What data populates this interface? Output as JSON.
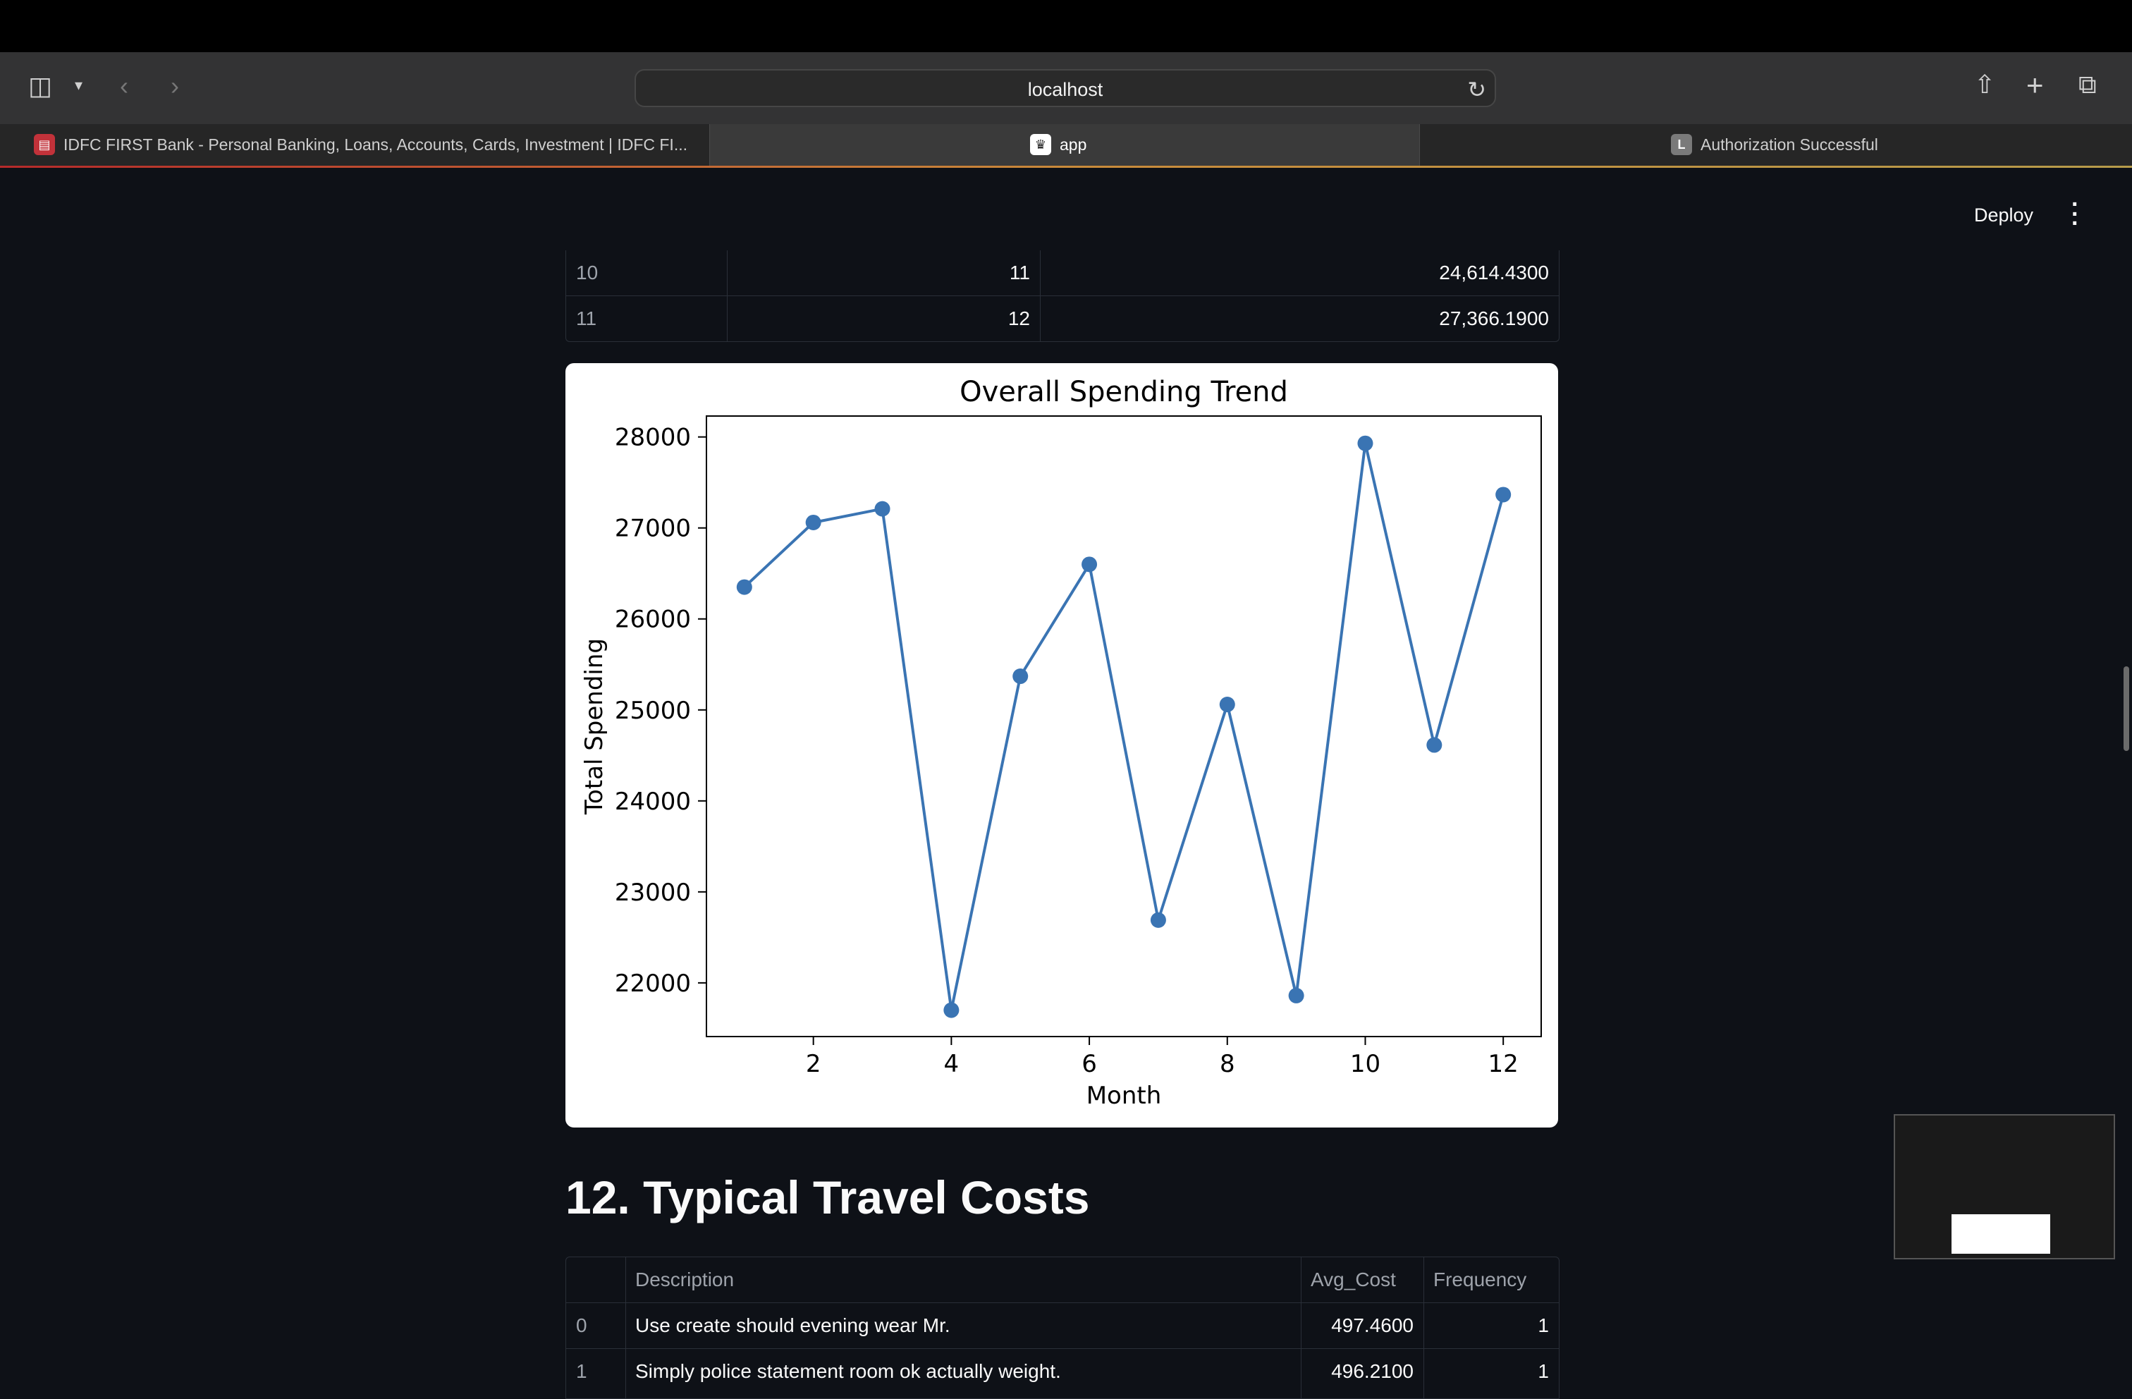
{
  "browser": {
    "url": "localhost",
    "tabs": [
      {
        "label": "IDFC FIRST Bank - Personal Banking, Loans, Accounts, Cards, Investment | IDFC FI...",
        "favicon": "idfc-icon"
      },
      {
        "label": "app",
        "favicon": "streamlit-crown-icon"
      },
      {
        "label": "Authorization Successful",
        "favicon": "L"
      }
    ]
  },
  "app": {
    "deploy_label": "Deploy",
    "menu_icon": "kebab-menu-icon"
  },
  "table1": {
    "rows": [
      [
        "10",
        "11",
        "24,614.4300"
      ],
      [
        "11",
        "12",
        "27,366.1900"
      ]
    ]
  },
  "chart_data": {
    "type": "line",
    "title": "Overall Spending Trend",
    "xlabel": "Month",
    "ylabel": "Total Spending",
    "x": [
      1,
      2,
      3,
      4,
      5,
      6,
      7,
      8,
      9,
      10,
      11,
      12
    ],
    "y": [
      26350,
      27060,
      27210,
      21700,
      25370,
      26600,
      22690,
      25060,
      21860,
      27930,
      24614.43,
      27366.19
    ],
    "xticks": [
      2,
      4,
      6,
      8,
      10,
      12
    ],
    "yticks": [
      22000,
      23000,
      24000,
      25000,
      26000,
      27000,
      28000
    ],
    "xlim": [
      0.45,
      12.55
    ],
    "ylim": [
      21410,
      28230
    ],
    "color": "#3a74b3",
    "grid": false
  },
  "section": {
    "heading": "12. Typical Travel Costs"
  },
  "table2": {
    "headers": [
      "",
      "Description",
      "Avg_Cost",
      "Frequency"
    ],
    "rows": [
      [
        "0",
        "Use create should evening wear Mr.",
        "497.4600",
        "1"
      ],
      [
        "1",
        "Simply police statement room ok actually weight.",
        "496.2100",
        "1"
      ]
    ]
  }
}
